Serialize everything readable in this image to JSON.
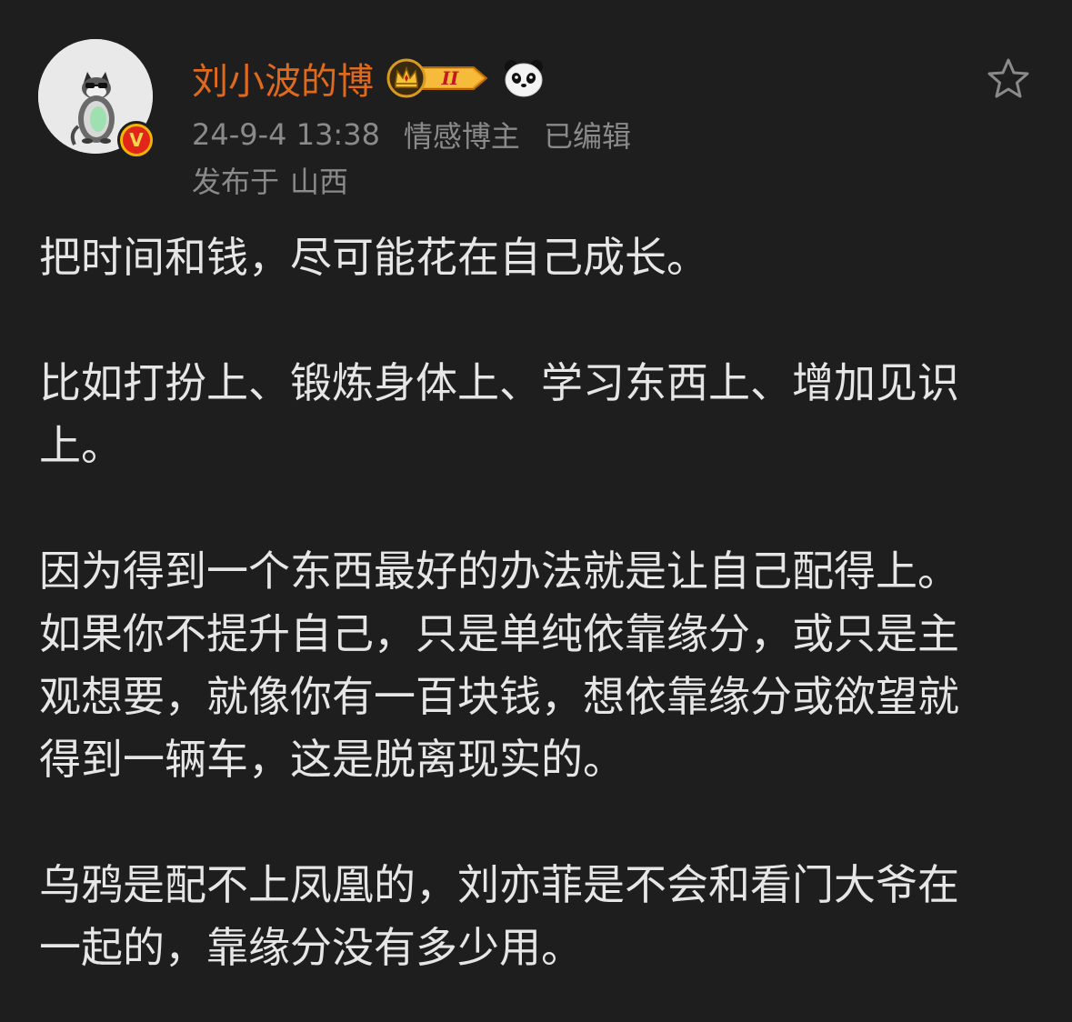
{
  "header": {
    "username": "刘小波的博",
    "level_badge_text": "II",
    "verified_badge_letter": "V",
    "timestamp": "24-9-4 13:38",
    "author_tag": "情感博主",
    "edited_label": "已编辑",
    "location_prefix": "发布于",
    "location": "山西"
  },
  "icons": {
    "avatar": "cat-avatar-icon",
    "verified": "verified-v-icon",
    "level": "crown-level-icon",
    "emoji": "panda-icon",
    "favorite": "star-outline-icon"
  },
  "colors": {
    "background": "#1e1e1e",
    "username": "#e06a1b",
    "meta": "#8a8a8a",
    "body_text": "#e6e6e6",
    "verified_badge": "#f5b400",
    "level_badge": "#f0a020"
  },
  "body": {
    "p1": {
      "l1": "把时间和钱，尽可能花在自己成长。"
    },
    "p2": {
      "l1": "比如打扮上、锻炼身体上、学习东西上、增加见识",
      "l2": "上。"
    },
    "p3": {
      "l1": "因为得到一个东西最好的办法就是让自己配得上。",
      "l2": "如果你不提升自己，只是单纯依靠缘分，或只是主",
      "l3": "观想要，就像你有一百块钱，想依靠缘分或欲望就",
      "l4": "得到一辆车，这是脱离现实的。"
    },
    "p4": {
      "l1": "乌鸦是配不上凤凰的，刘亦菲是不会和看门大爷在",
      "l2": "一起的，靠缘分没有多少用。"
    }
  }
}
